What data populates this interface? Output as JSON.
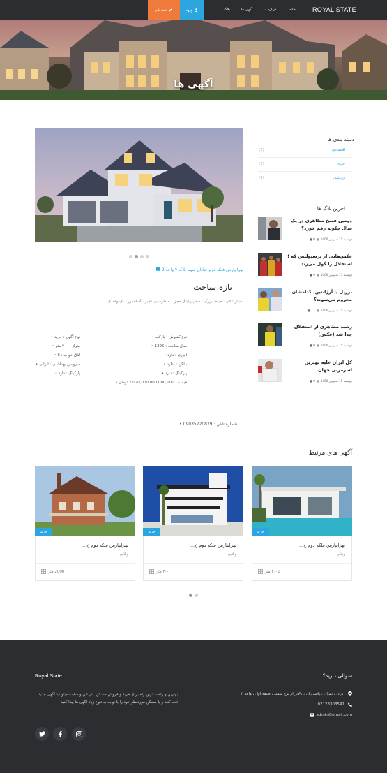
{
  "nav": {
    "brand": "ROYAL STATE",
    "links": [
      "خانه",
      "درباره ما",
      "آگهی ها",
      "بلاگ"
    ],
    "login": "ورود",
    "register": "ثبت نام"
  },
  "hero": {
    "title": "آگهی ها"
  },
  "listing": {
    "address": "تهرانپارس فلکه دوم خیابان سوم پلاک ۴ واحد 2",
    "title": "تازه ساخت",
    "description": "بسیار عالی ، حیاط بزرگ ، سه پارکینگ مجزا ، منظره بی نظیر ، آسانسور ، تک واحدی",
    "specs_right": [
      "نوع آگهی : خرید",
      "متراژ : ۲۰۰ متر",
      "اتاق خواب : 6",
      "سرویس بهداشتی : ایرانی",
      "پارکینگ : دارد"
    ],
    "specs_left": [
      "نوع کفپوش : پارکت",
      "سال ساخت : 1395",
      "انباری : دارد",
      "بالکن : ندارد",
      "پارکینگ : دارد",
      "قیمت : 2,020,000,000,000,000 تومان"
    ],
    "phone": "شماره تلفن : 09035720879"
  },
  "sidebar": {
    "categories_title": "دسته بندی ها",
    "categories": [
      {
        "name": "اقتصادی",
        "count": "(2)"
      },
      {
        "name": "خبری",
        "count": "(2)"
      },
      {
        "name": "ورزشی",
        "count": "(5)"
      }
    ],
    "posts_title": "اخرین بلاگ ها",
    "posts": [
      {
        "title": "دومین فسخ مظاهری در یک سال چگونه رقم خورد؟",
        "count": "0",
        "date": "دوشنبه 15 شهریور 1400"
      },
      {
        "title": "عکس‌هایی از پرسپولیس که !استقلال را گول می‌زند",
        "count": "0",
        "date": "دوشنبه 15 شهریور 1400"
      },
      {
        "title": "برزیل یا آرژانتین، کدامشان محروم می‌شوند؟",
        "count": "11",
        "date": "دوشنبه 15 شهریور 1400"
      },
      {
        "title": "رشید مظاهری از استقلال جدا شد (عکس)",
        "count": "0",
        "date": "دوشنبه 15 شهریور 1400"
      },
      {
        "title": "کل ایران علیه بهترین اسرمربی جهان",
        "count": "0",
        "date": "دوشنبه 15 شهریور 1400"
      }
    ]
  },
  "related": {
    "title": "آگهی های مرتبط",
    "cards": [
      {
        "title": "تهرانپارس فلکه دوم خ...",
        "type": "ویلایی",
        "tag": "خرید",
        "area": "2000 متر"
      },
      {
        "title": "تهرانپارس فلکه دوم خ...",
        "type": "ویلایی",
        "tag": "خرید",
        "area": "۲۰۰ متر"
      },
      {
        "title": "تهرانپارس فلکه دوم خ...",
        "type": "ویلایی",
        "tag": "خرید",
        "area": "۲۰۰0 متر"
      }
    ]
  },
  "footer": {
    "left_title": "Royal State",
    "left_text": "بهترین و راحت ترین راه برای خرید و فروش مسکن . در این وبسایت میتوانید آگهی جدید ثبت کنید و یا مسکن موردنظر خود را با توجه به تنوع زیاد آگهی ها پیدا کنید",
    "right_title": "سوالی دارید؟",
    "address": "ایران ، تهران ، پاسداران ، بالاتر از برج سفید ، طبقه اول ، واحد ۳",
    "phone": "02128303541",
    "email": "admin@gmail.com"
  },
  "colors": {
    "accent": "#2da6e0",
    "register": "#f07a3c",
    "dark": "#2b2d31"
  }
}
